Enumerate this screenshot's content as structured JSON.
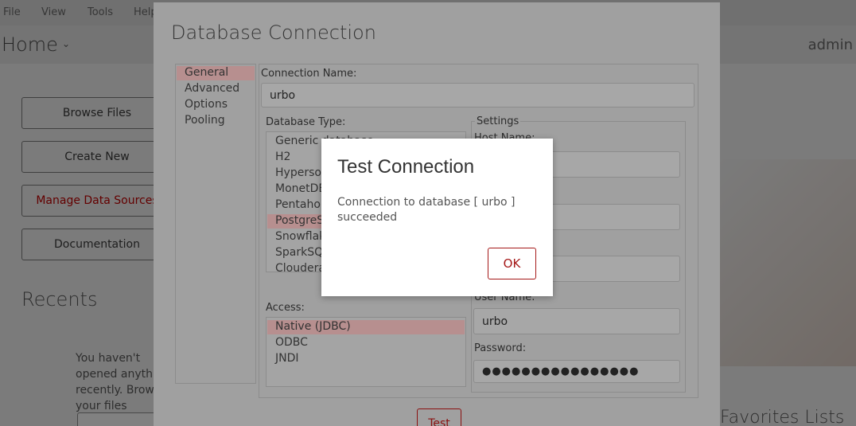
{
  "menu": [
    "File",
    "View",
    "Tools",
    "Help"
  ],
  "home": {
    "title": "Home",
    "user": "admin"
  },
  "sidebar_buttons": [
    "Browse Files",
    "Create New",
    "Manage Data Sources",
    "Documentation"
  ],
  "recents": {
    "title": "Recents",
    "message": "You haven't opened anything recently. Browse your files"
  },
  "right_panel_label": "Favorites Lists",
  "dialog": {
    "title": "Database Connection",
    "nav": [
      "General",
      "Advanced",
      "Options",
      "Pooling"
    ],
    "connection_name_label": "Connection Name:",
    "connection_name": "urbo",
    "db_type_label": "Database Type:",
    "db_types": [
      "Generic database",
      "H2",
      "Hypersonic",
      "MonetDB",
      "Pentaho Data Services",
      "PostgreSQL",
      "Snowflake",
      "SparkSQL",
      "Cloudera Impala"
    ],
    "access_label": "Access:",
    "access": [
      "Native (JDBC)",
      "ODBC",
      "JNDI"
    ],
    "settings_label": "Settings",
    "host_label": "Host Name:",
    "username_label": "User Name:",
    "username": "urbo",
    "password_label": "Password:",
    "password": "●●●●●●●●●●●●●●●●",
    "test_label": "Test"
  },
  "modal": {
    "title": "Test Connection",
    "message": "Connection to database [ urbo ] succeeded",
    "ok_label": "OK"
  },
  "colors": {
    "accent": "#a51818",
    "selection": "#e8bcbc"
  }
}
